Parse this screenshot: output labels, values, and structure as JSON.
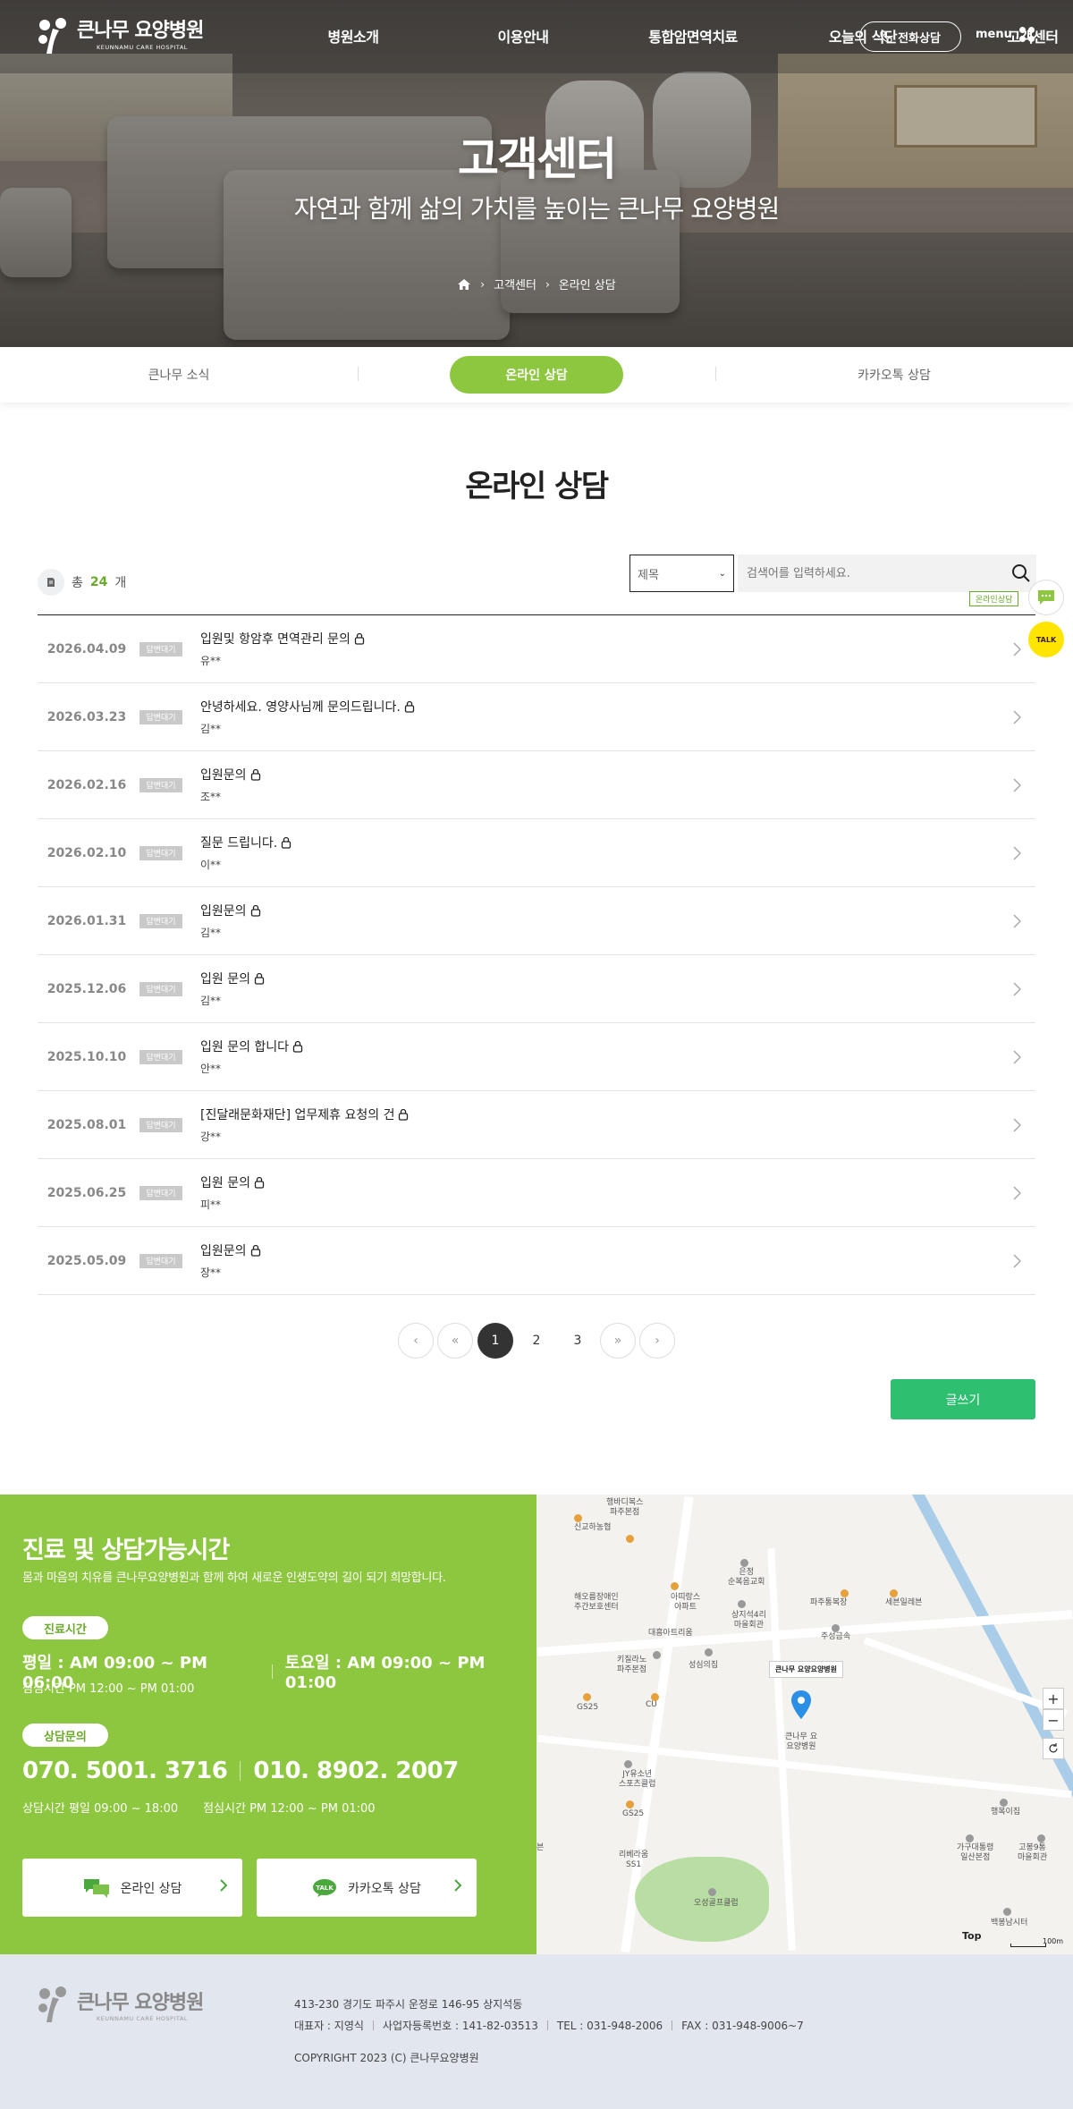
{
  "header": {
    "logo_name": "큰나무 요양병원",
    "logo_sub": "KEUNNAMU CARE HOSPITAL",
    "nav": [
      "병원소개",
      "이용안내",
      "통합암면역치료",
      "오늘의 식단",
      "고객센터"
    ],
    "phone_button": "전화상담",
    "menu_label": "menu"
  },
  "hero": {
    "title": "고객센터",
    "subtitle": "자연과 함께 삶의 가치를 높이는 큰나무 요양병원",
    "breadcrumb": [
      "고객센터",
      "온라인 상담"
    ]
  },
  "tabs": [
    "큰나무 소식",
    "온라인 상담",
    "카카오톡 상담"
  ],
  "active_tab": "온라인 상담",
  "page_title": "온라인 상담",
  "board": {
    "total_prefix": "총",
    "total_count": "24",
    "total_suffix": "개",
    "search_select": "제목",
    "search_placeholder": "검색어를 입력하세요.",
    "rows": [
      {
        "date": "2026.04.09",
        "badge": "답변대기",
        "title": "입원및 항암후 면역관리 문의",
        "writer": "유**"
      },
      {
        "date": "2026.03.23",
        "badge": "답변대기",
        "title": "안녕하세요. 영양사님께 문의드립니다.",
        "writer": "김**"
      },
      {
        "date": "2026.02.16",
        "badge": "답변대기",
        "title": "입원문의",
        "writer": "조**"
      },
      {
        "date": "2026.02.10",
        "badge": "답변대기",
        "title": "질문 드립니다.",
        "writer": "이**"
      },
      {
        "date": "2026.01.31",
        "badge": "답변대기",
        "title": "입원문의",
        "writer": "김**"
      },
      {
        "date": "2025.12.06",
        "badge": "답변대기",
        "title": "입원 문의",
        "writer": "김**"
      },
      {
        "date": "2025.10.10",
        "badge": "답변대기",
        "title": "입원 문의 합니다",
        "writer": "안**"
      },
      {
        "date": "2025.08.01",
        "badge": "답변대기",
        "title": "[진달래문화재단] 업무제휴 요청의 건",
        "writer": "강**"
      },
      {
        "date": "2025.06.25",
        "badge": "답변대기",
        "title": "입원 문의",
        "writer": "피**"
      },
      {
        "date": "2025.05.09",
        "badge": "답변대기",
        "title": "입원문의",
        "writer": "장**"
      }
    ],
    "pages": [
      "1",
      "2",
      "3"
    ],
    "current_page": "1",
    "write_button": "글쓰기"
  },
  "quick": {
    "label": "온라인상담",
    "talk": "TALK"
  },
  "info": {
    "title": "진료 및 상담가능시간",
    "desc": "몸과 마음의 치유를 큰나무요양병원과 함께 하여 새로운 인생도약의 길이 되기 희망합니다.",
    "clinic_label": "진료시간",
    "weekday": "평일 : AM 09:00 ~ PM 06:00",
    "saturday": "토요일 : AM 09:00 ~ PM 01:00",
    "lunch": "점심시간 PM 12:00 ~ PM 01:00",
    "consult_label": "상담문의",
    "tel1": "070. 5001. 3716",
    "tel2": "010. 8902. 2007",
    "consult_time": "상담시간 평일 09:00 ~ 18:00",
    "consult_lunch": "점심시간 PM 12:00 ~ PM 01:00",
    "btn_online": "온라인 상담",
    "btn_kakao": "카카오톡 상담"
  },
  "map": {
    "hospital_tag": "큰나무 요양요양병원",
    "hospital_label": "큰나무 요\n요양병원",
    "labels": [
      "신교하농협",
      "행바디복스\n파주본점",
      "해오름장애인\n주간보호센터",
      "아띠랑스\n아파트",
      "은정\n순복음교회",
      "상지석4리\n마을회관",
      "파주통복장",
      "세븐일레븐",
      "주성금속",
      "대흥아트리움",
      "키질라노\n파주본점",
      "성심의집",
      "GS25",
      "CU",
      "JY유소년\n스포츠클럽",
      "GS25",
      "리베라움\nSS1",
      "오성골프클럽",
      "행복이집",
      "가구대통령\n일산본점",
      "고봉9통\n마을회관",
      "백봉남시터",
      "Top",
      "100m",
      "븐"
    ],
    "zoom_in": "+",
    "zoom_out": "−"
  },
  "footer": {
    "logo_name": "큰나무 요양병원",
    "logo_sub": "KEUNNAMU CARE HOSPITAL",
    "address": "413-230 경기도 파주시 운정로 146-95 상지석동",
    "ceo": "대표자 : 지영식",
    "biz": "사업자등록번호 : 141-82-03513",
    "tel": "TEL : 031-948-2006",
    "fax": "FAX : 031-948-9006~7",
    "copyright": "COPYRIGHT 2023 (C) 큰나무요양병원"
  },
  "colors": {
    "accent": "#8dc63f",
    "write": "#2fbf71",
    "kakao": "#fee500"
  }
}
